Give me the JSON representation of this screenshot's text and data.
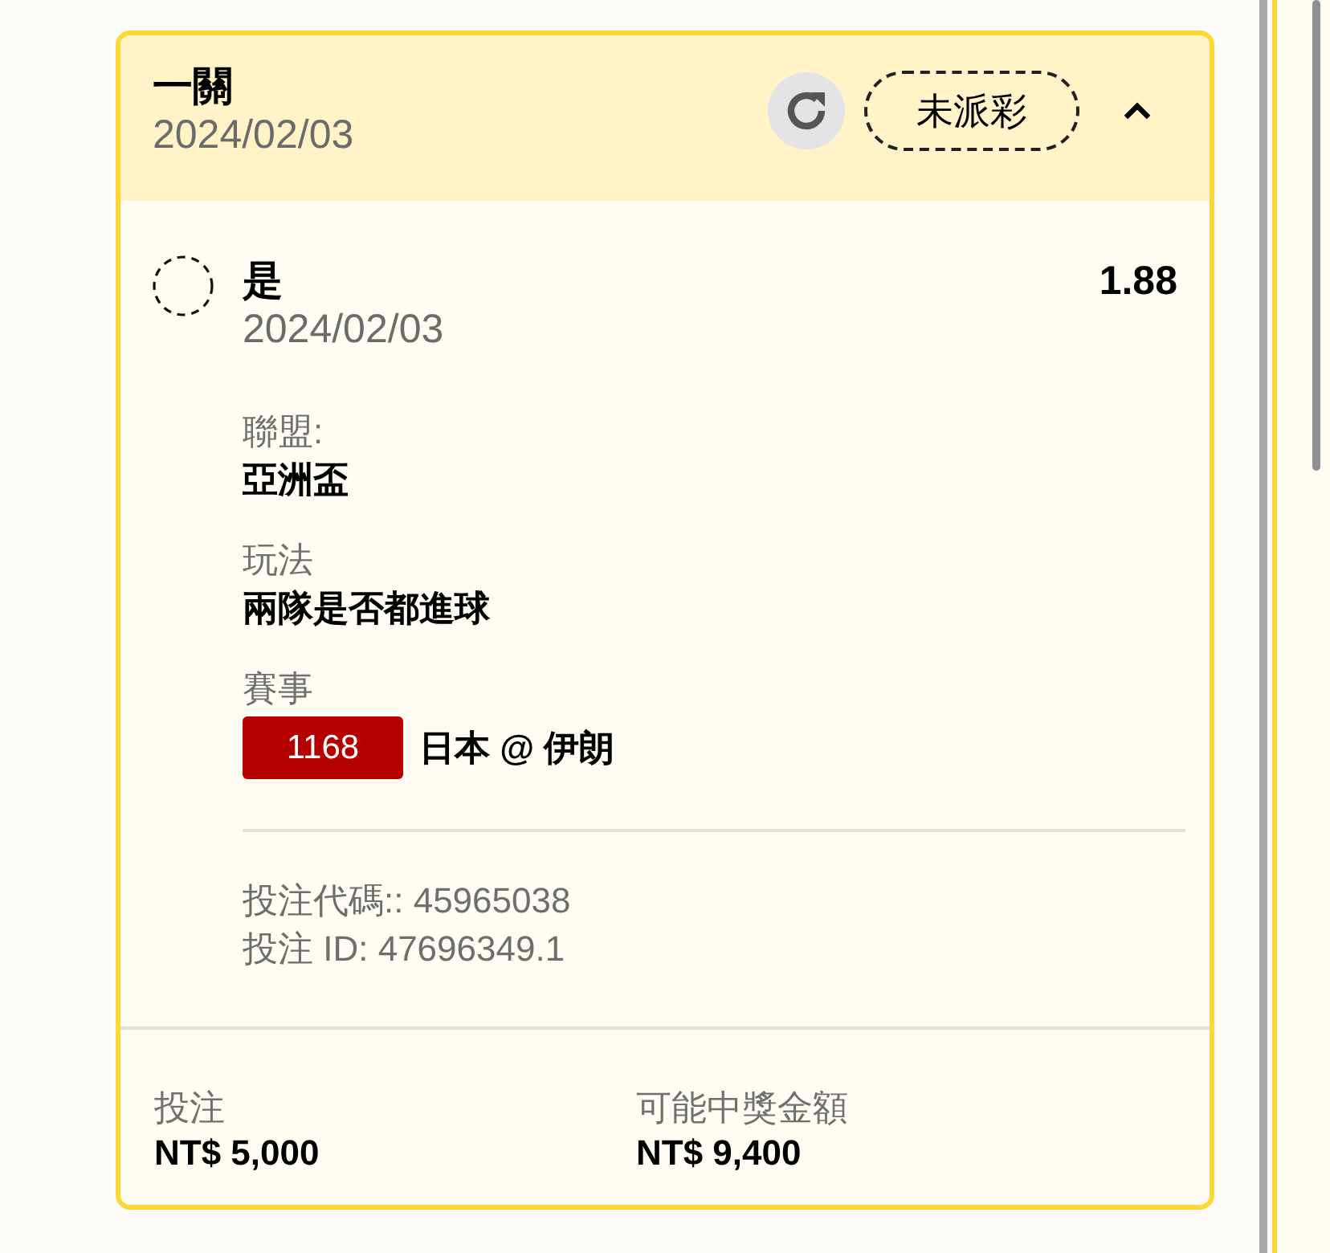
{
  "bet_card": {
    "title": "一關",
    "date": "2024/02/03",
    "status_badge": "未派彩",
    "expanded": true,
    "selection": {
      "pick": "是",
      "date": "2024/02/03",
      "odds": "1.88"
    },
    "details": [
      {
        "kind": "text",
        "label": "聯盟:",
        "value": "亞洲盃"
      },
      {
        "kind": "text",
        "label": "玩法",
        "value": "兩隊是否都進球"
      },
      {
        "kind": "match",
        "label": "賽事",
        "match_number": "1168",
        "value": "日本 @ 伊朗"
      }
    ],
    "bet_code": "投注代碼:: 45965038",
    "bet_id": "投注 ID: 47696349.1",
    "footer": [
      {
        "label": "投注",
        "value": "NT$ 5,000"
      },
      {
        "label": "可能中獎金額",
        "value": "NT$ 9,400"
      }
    ]
  }
}
